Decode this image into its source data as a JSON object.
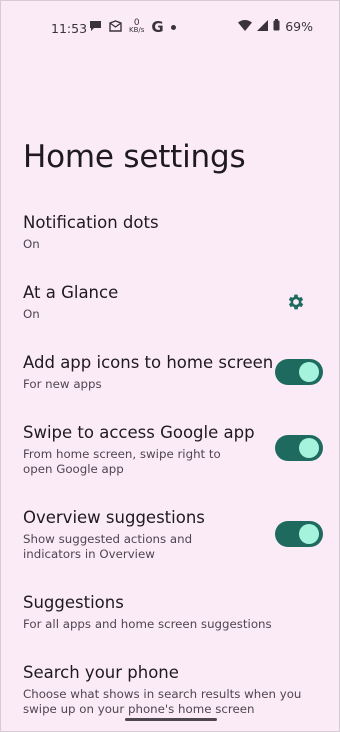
{
  "status_bar": {
    "time": "11:53",
    "kbps_value": "0",
    "kbps_unit": "KB/s",
    "google": "G",
    "battery_percent": "69%"
  },
  "page": {
    "title": "Home settings"
  },
  "settings": [
    {
      "label": "Notification dots",
      "sub": "On",
      "control": "none"
    },
    {
      "label": "At a Glance",
      "sub": "On",
      "control": "gear-icon"
    },
    {
      "label": "Add app icons to home screen",
      "sub": "For new apps",
      "control": "toggle",
      "checked": true
    },
    {
      "label": "Swipe to access Google app",
      "sub": "From home screen, swipe right to open Google app",
      "control": "toggle",
      "checked": true
    },
    {
      "label": "Overview suggestions",
      "sub": "Show suggested actions and indicators in Overview",
      "control": "toggle",
      "checked": true
    },
    {
      "label": "Suggestions",
      "sub": "For all apps and home screen suggestions",
      "control": "none"
    },
    {
      "label": "Search your phone",
      "sub": "Choose what shows in search results when you swipe up on your phone's home screen",
      "control": "none"
    }
  ],
  "colors": {
    "background": "#fbebf7",
    "toggle_track": "#1f6a5e",
    "toggle_knob": "#a6f3dd",
    "gear": "#1f6a5e"
  }
}
